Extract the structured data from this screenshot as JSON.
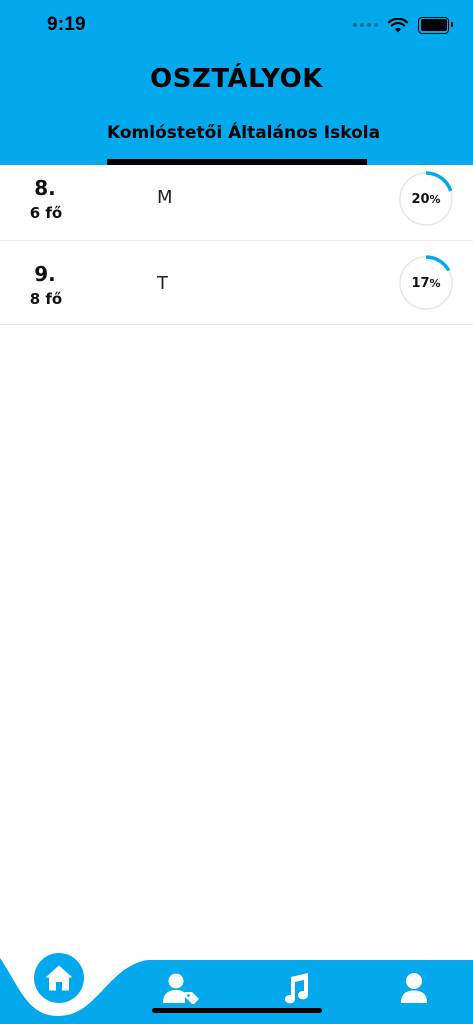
{
  "status_bar": {
    "time": "9:19"
  },
  "header": {
    "title": "OSZTÁLYOK",
    "tab_label": "Komlóstetői Általános Iskola"
  },
  "classes": [
    {
      "grade": "8.",
      "count": "6 fő",
      "teacher": "M",
      "progress_value": "20",
      "progress_unit": "%",
      "progress": 0.2
    },
    {
      "grade": "9.",
      "count": "8 fő",
      "teacher": "T",
      "progress_value": "17",
      "progress_unit": "%",
      "progress": 0.17
    }
  ],
  "nav": {
    "items": [
      {
        "icon": "home-icon",
        "active": true
      },
      {
        "icon": "user-tag-icon",
        "active": false
      },
      {
        "icon": "music-note-icon",
        "active": false
      },
      {
        "icon": "person-icon",
        "active": false
      }
    ]
  },
  "colors": {
    "accent": "#03a9ec",
    "ring_track": "#e6e6e6",
    "icon": "#ffffff",
    "text": "#111111"
  }
}
